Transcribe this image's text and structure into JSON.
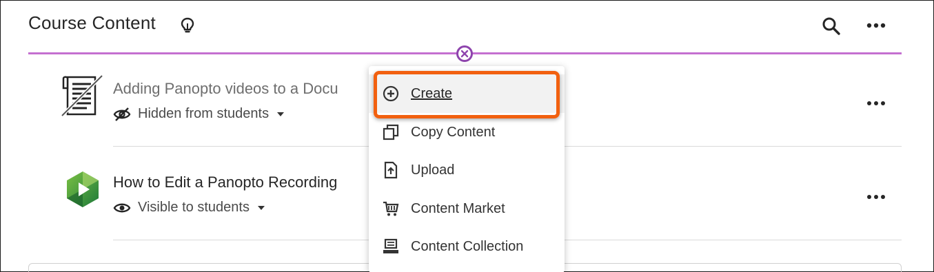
{
  "header": {
    "title": "Course Content",
    "icons": {
      "lightbulb": "lightbulb-icon",
      "search": "search-icon",
      "more": "more-horizontal-icon"
    }
  },
  "divider": {
    "color": "#c46fd0",
    "close_icon": "close-circle-icon",
    "close_color": "#8e44ad"
  },
  "items": [
    {
      "title": "Adding Panopto videos to a Docu",
      "visibility": "Hidden from students",
      "visibility_icon": "eye-slash-icon",
      "icon": "document-hidden-icon"
    },
    {
      "title": "How to Edit a Panopto Recording",
      "visibility": "Visible to students",
      "visibility_icon": "eye-icon",
      "icon": "panopto-logo-icon"
    }
  ],
  "menu": {
    "items": [
      {
        "label": "Create",
        "icon": "plus-circle-icon",
        "highlighted": true
      },
      {
        "label": "Copy Content",
        "icon": "copy-icon"
      },
      {
        "label": "Upload",
        "icon": "upload-file-icon"
      },
      {
        "label": "Content Market",
        "icon": "cart-icon"
      },
      {
        "label": "Content Collection",
        "icon": "collection-icon"
      }
    ],
    "highlight_color": "#f2600f"
  }
}
